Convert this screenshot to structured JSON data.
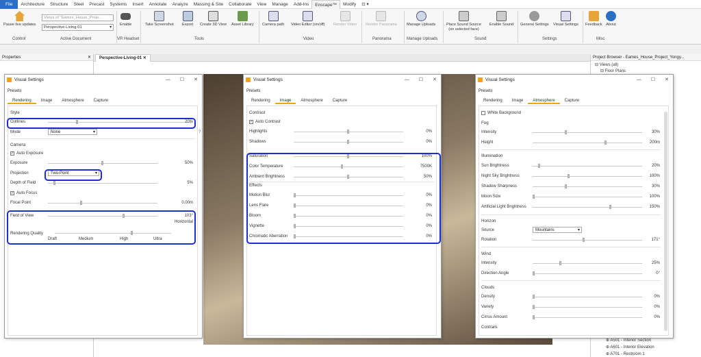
{
  "menubar": {
    "file": "File",
    "items": [
      "Architecture",
      "Structure",
      "Steel",
      "Precast",
      "Systems",
      "Insert",
      "Annotate",
      "Analyze",
      "Massing & Site",
      "Collaborate",
      "View",
      "Manage",
      "Add-Ins",
      "Enscape™",
      "Modify",
      "⊡ ▾"
    ]
  },
  "ribbon": {
    "pause": "Pause live updates",
    "project_placeholder": "Views of \"Eames_House_Proje...",
    "view_select": "Perspective-Living-01",
    "enable": "Enable",
    "take_screenshot": "Take Screenshot",
    "export": "Export",
    "create_3d_view": "Create 3D View",
    "asset_library": "Asset Library",
    "camera_path": "Camera path",
    "video_editor": "Video Editor (on/off)",
    "render_video": "Render Video",
    "render_panorama": "Render Panorama",
    "manage_uploads": "Manage Uploads",
    "place_sound": "Place Sound Source",
    "place_sound2": "(on selected face)",
    "enable_sound": "Enable Sound",
    "general_settings": "General Settings",
    "visual_settings": "Visual Settings",
    "feedback": "Feedback",
    "about": "About",
    "groups": {
      "control": "Control",
      "active_document": "Active Document",
      "vr_headset": "VR Headset",
      "tools": "Tools",
      "video": "Video",
      "panorama": "Panorama",
      "manage_uploads": "Manage Uploads",
      "sound": "Sound",
      "settings": "Settings",
      "misc": "Misc"
    }
  },
  "properties": {
    "title": "Properties",
    "close": "✕"
  },
  "doc_tab": {
    "label": "Perspective-Living-01",
    "close": "✕"
  },
  "browser": {
    "title": "Project Browser - Eames_House_Project_Yongy...",
    "close": "✕",
    "views": "Views (all)",
    "floor_plans": "Floor Plans",
    "items": [
      "A501 - Interior Section",
      "A601 - Interior Elevation",
      "A701 - Restroom 1"
    ]
  },
  "dialog": {
    "title": "Visual Settings",
    "presets": "Presets",
    "tabs": [
      "Rendering",
      "Image",
      "Atmosphere",
      "Capture"
    ],
    "min": "—",
    "max": "☐",
    "close": "✕"
  },
  "rendering": {
    "style": "Style",
    "outlines": "Outlines",
    "outlines_val": "20%",
    "mode": "Mode",
    "mode_val": "None",
    "camera": "Camera",
    "auto_exposure": "Auto Exposure",
    "exposure": "Exposure",
    "exposure_val": "50%",
    "projection": "Projection",
    "projection_val": "Two-Point",
    "dof": "Depth of Field",
    "dof_val": "5%",
    "auto_focus": "Auto Focus",
    "focal": "Focal Point",
    "focal_val": "0.00m",
    "fov": "Field of View",
    "fov_val": "103°",
    "fov_val2": "Horizontal",
    "quality": "Rendering Quality",
    "q_levels": [
      "Draft",
      "Medium",
      "High",
      "Ultra"
    ],
    "help": "?"
  },
  "image": {
    "contrast": "Contrast",
    "auto_contrast": "Auto Contrast",
    "highlights": "Highlights",
    "highlights_val": "0%",
    "shadows": "Shadows",
    "shadows_val": "0%",
    "saturation": "Saturation",
    "saturation_val": "100%",
    "color_temp": "Color Temperature",
    "color_temp_val": "7500K",
    "ambient": "Ambient Brightness",
    "ambient_val": "50%",
    "effects": "Effects",
    "motion_blur": "Motion Blur",
    "motion_blur_val": "0%",
    "lens_flare": "Lens Flare",
    "lens_flare_val": "0%",
    "bloom": "Bloom",
    "bloom_val": "0%",
    "vignette": "Vignette",
    "vignette_val": "0%",
    "chromatic": "Chromatic Aberration",
    "chromatic_val": "0%"
  },
  "atmosphere": {
    "white_bg": "White Background",
    "fog": "Fog",
    "intensity": "Intensity",
    "intensity_val": "30%",
    "height": "Height",
    "height_val": "200m",
    "illumination": "Illumination",
    "sun": "Sun Brightness",
    "sun_val": "20%",
    "night_sky": "Night Sky Brightness",
    "night_sky_val": "100%",
    "shadow_sharp": "Shadow Sharpness",
    "shadow_sharp_val": "30%",
    "moon": "Moon Size",
    "moon_val": "100%",
    "artificial": "Artificial Light Brightness",
    "artificial_val": "150%",
    "horizon": "Horizon",
    "source": "Source",
    "source_val": "Mountains",
    "rotation": "Rotation",
    "rotation_val": "171°",
    "wind": "Wind",
    "wind_int": "Intensity",
    "wind_int_val": "25%",
    "direction": "Direction Angle",
    "direction_val": "0°",
    "clouds": "Clouds",
    "density": "Density",
    "density_val": "0%",
    "variety": "Variety",
    "variety_val": "0%",
    "cirrus": "Cirrus Amount",
    "cirrus_val": "0%",
    "contrails": "Contrails"
  },
  "colors": {
    "accent": "#f2a31b",
    "highlight": "#1b2ecf",
    "file_tab": "#2b6fc5"
  },
  "sliders": {
    "outlines": 0.2,
    "exposure": 0.5,
    "dof": 0.05,
    "focal": 0.3,
    "fov": 0.7,
    "quality": 0.67,
    "highlights": 0.5,
    "shadows": 0.5,
    "saturation": 0.5,
    "color_temp": 0.44,
    "ambient": 0.5,
    "motion_blur": 0.0,
    "lens_flare": 0.0,
    "bloom": 0.0,
    "vignette": 0.0,
    "chromatic": 0.0,
    "fog_intensity": 0.3,
    "fog_height": 0.67,
    "sun": 0.05,
    "night_sky": 0.33,
    "shadow_sharp": 0.3,
    "moon": 0.0,
    "artificial": 0.72,
    "rotation": 0.47,
    "wind": 0.25,
    "direction": 0.0,
    "density": 0.0,
    "variety": 0.0,
    "cirrus": 0.0
  }
}
